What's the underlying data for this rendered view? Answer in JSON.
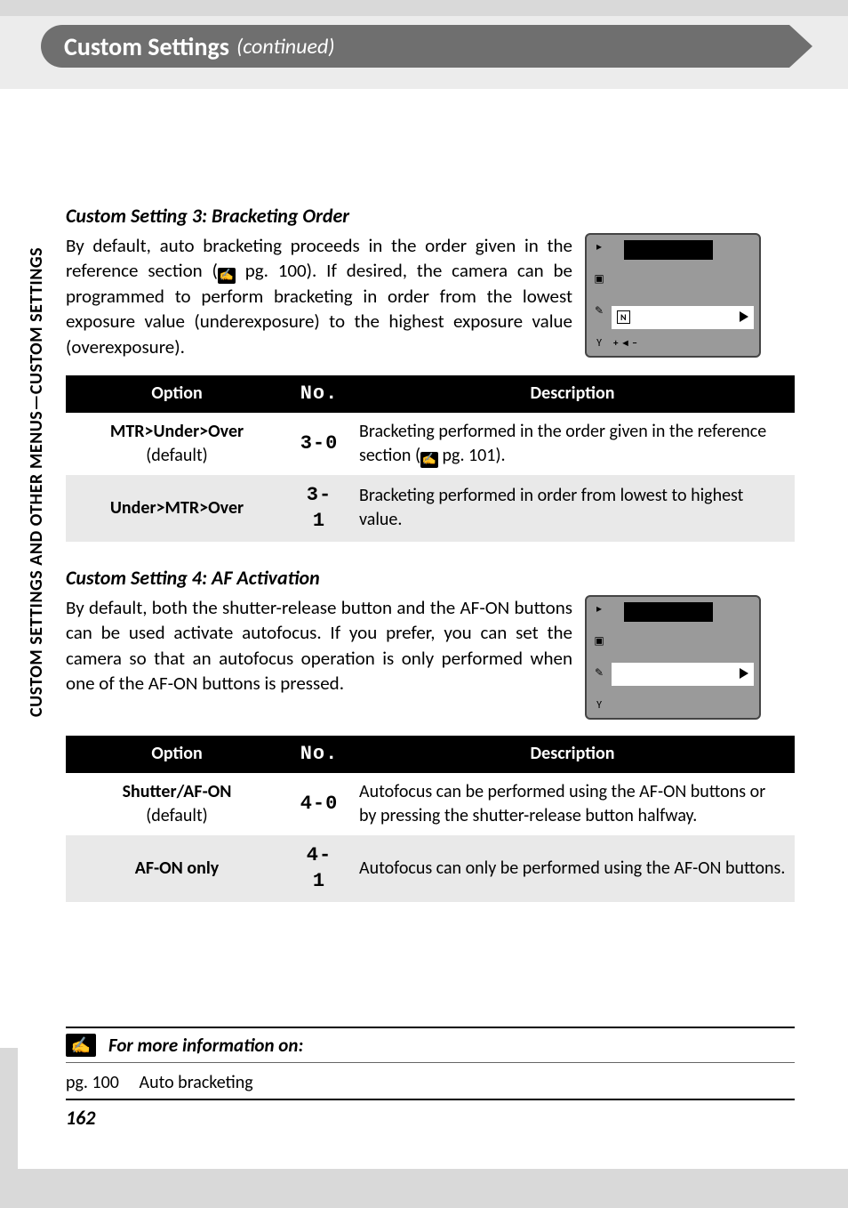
{
  "header": {
    "title": "Custom Settings",
    "continued": "(continued)"
  },
  "side_label": "CUSTOM SETTINGS AND OTHER MENUS—CUSTOM SETTINGS",
  "sections": [
    {
      "heading": "Custom Setting 3: Bracketing Order",
      "intro_pre": "By default, auto bracketing proceeds in the order given in the reference section (",
      "ref_icon": "✍",
      "intro_mid": " pg. 100).  If desired, the camera can be programmed to perform bracketing in order from the low­est exposure value (underexposure) to the highest exposure value (overexposure).",
      "thumb": {
        "variant": "bracketing"
      },
      "table": {
        "headers": [
          "Option",
          "No.",
          "Description"
        ],
        "rows": [
          {
            "option": "MTR>Under>Over",
            "sub": "(default)",
            "no": "3-0",
            "desc_pre": "Bracketing performed in the order given in the ref­erence section (",
            "desc_icon": "✍",
            "desc_post": " pg. 101)."
          },
          {
            "option": "Under>MTR>Over",
            "sub": "",
            "no": "3- 1",
            "desc_pre": "Bracketing performed in order from lowest to high­est value.",
            "desc_icon": "",
            "desc_post": ""
          }
        ]
      }
    },
    {
      "heading": "Custom Setting 4: AF Activation",
      "intro_pre": "By default, both the shutter-release button and the AF-ON buttons can be used activate autofocus.  If you prefer, you can set the camera so that an autofocus operation is only per­formed when one of the AF-ON buttons is pressed.",
      "ref_icon": "",
      "intro_mid": "",
      "thumb": {
        "variant": "af"
      },
      "table": {
        "headers": [
          "Option",
          "No.",
          "Description"
        ],
        "rows": [
          {
            "option": "Shutter/AF-ON",
            "sub": "(default)",
            "no": "4-0",
            "desc_pre": "Autofocus can be performed using the AF-ON but­tons or by pressing the shutter-release button half­way.",
            "desc_icon": "",
            "desc_post": ""
          },
          {
            "option": "AF-ON only",
            "sub": "",
            "no": "4- 1",
            "desc_pre": "Autofocus can only be performed using the AF-ON buttons.",
            "desc_icon": "",
            "desc_post": ""
          }
        ]
      }
    }
  ],
  "footer": {
    "info_heading": "For more information on:",
    "info_icon": "✍",
    "line_pg": "pg. 100",
    "line_text": "Auto bracketing",
    "page_number": "162"
  }
}
